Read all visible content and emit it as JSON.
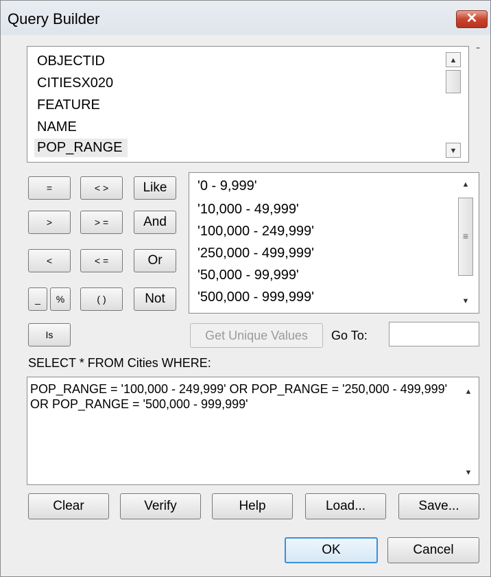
{
  "window": {
    "title": "Query Builder",
    "close_glyph": "✕"
  },
  "menu_arrow": "⁼",
  "fields": {
    "items": [
      "OBJECTID",
      "CITIESX020",
      "FEATURE",
      "NAME",
      "POP_RANGE"
    ],
    "selected": "POP_RANGE"
  },
  "operators": {
    "eq": "=",
    "ne": "< >",
    "like": "Like",
    "gt": ">",
    "ge": "> =",
    "and": "And",
    "lt": "<",
    "le": "< =",
    "or": "Or",
    "underscore": "_",
    "percent": "%",
    "parens": "( )",
    "not": "Not",
    "is": "Is"
  },
  "values": {
    "items": [
      "'0 - 9,999'",
      "'10,000 - 49,999'",
      "'100,000 - 249,999'",
      "'250,000 - 499,999'",
      "'50,000 - 99,999'",
      "'500,000 - 999,999'"
    ]
  },
  "scroll_glyphs": {
    "up": "▲",
    "down": "▼",
    "grip": "≡"
  },
  "get_unique_values": "Get Unique Values",
  "goto_label": "Go To:",
  "goto_value": "",
  "select_label": "SELECT * FROM Cities WHERE:",
  "expression": "POP_RANGE = '100,000 - 249,999' OR POP_RANGE = '250,000 - 499,999' OR POP_RANGE = '500,000 - 999,999'",
  "actions": {
    "clear": "Clear",
    "verify": "Verify",
    "help": "Help",
    "load": "Load...",
    "save": "Save..."
  },
  "dialog_buttons": {
    "ok": "OK",
    "cancel": "Cancel"
  }
}
